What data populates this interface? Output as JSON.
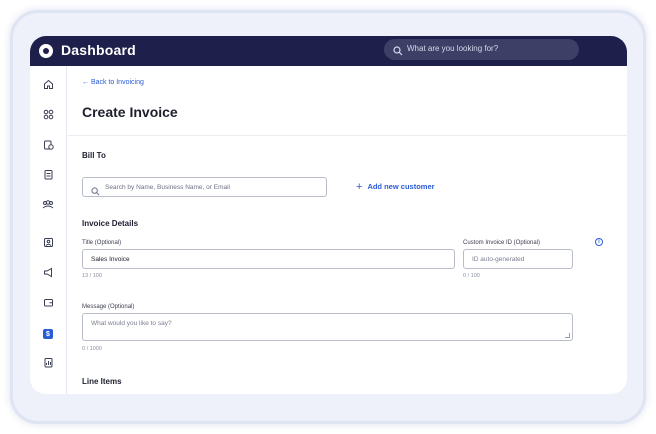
{
  "app": {
    "title": "Dashboard"
  },
  "search": {
    "placeholder": "What are you looking for?"
  },
  "sidebar": {
    "items": [
      {
        "name": "home",
        "icon": "home-icon"
      },
      {
        "name": "integrations",
        "icon": "apps-icon"
      },
      {
        "name": "tasks",
        "icon": "clipboard-clock-icon"
      },
      {
        "name": "documents",
        "icon": "document-icon"
      },
      {
        "name": "customers",
        "icon": "users-icon"
      },
      {
        "name": "contacts",
        "icon": "contact-card-icon"
      },
      {
        "name": "marketing",
        "icon": "megaphone-icon"
      },
      {
        "name": "wallet",
        "icon": "wallet-icon"
      },
      {
        "name": "invoicing",
        "icon": "dollar-icon",
        "badge": "$",
        "active": true
      },
      {
        "name": "reports",
        "icon": "report-icon"
      }
    ]
  },
  "page": {
    "back_link": "← Back to Invoicing",
    "title": "Create Invoice"
  },
  "bill_to": {
    "heading": "Bill To",
    "search_placeholder": "Search by Name, Business Name, or Email",
    "add_customer": "Add new customer"
  },
  "invoice_details": {
    "heading": "Invoice Details",
    "title_label": "Title (Optional)",
    "title_value": "Sales Invoice",
    "title_counter": "13 / 100",
    "custom_id_label": "Custom Invoice ID (Optional)",
    "custom_id_placeholder": "ID auto-generated",
    "custom_id_counter": "0 / 100",
    "message_label": "Message (Optional)",
    "message_placeholder": "What would you like to say?",
    "message_counter": "0 / 1000"
  },
  "line_items": {
    "heading": "Line Items"
  },
  "colors": {
    "topbar": "#1e1f4b",
    "accent": "#2a5bd7",
    "frame": "#eef1fa"
  }
}
